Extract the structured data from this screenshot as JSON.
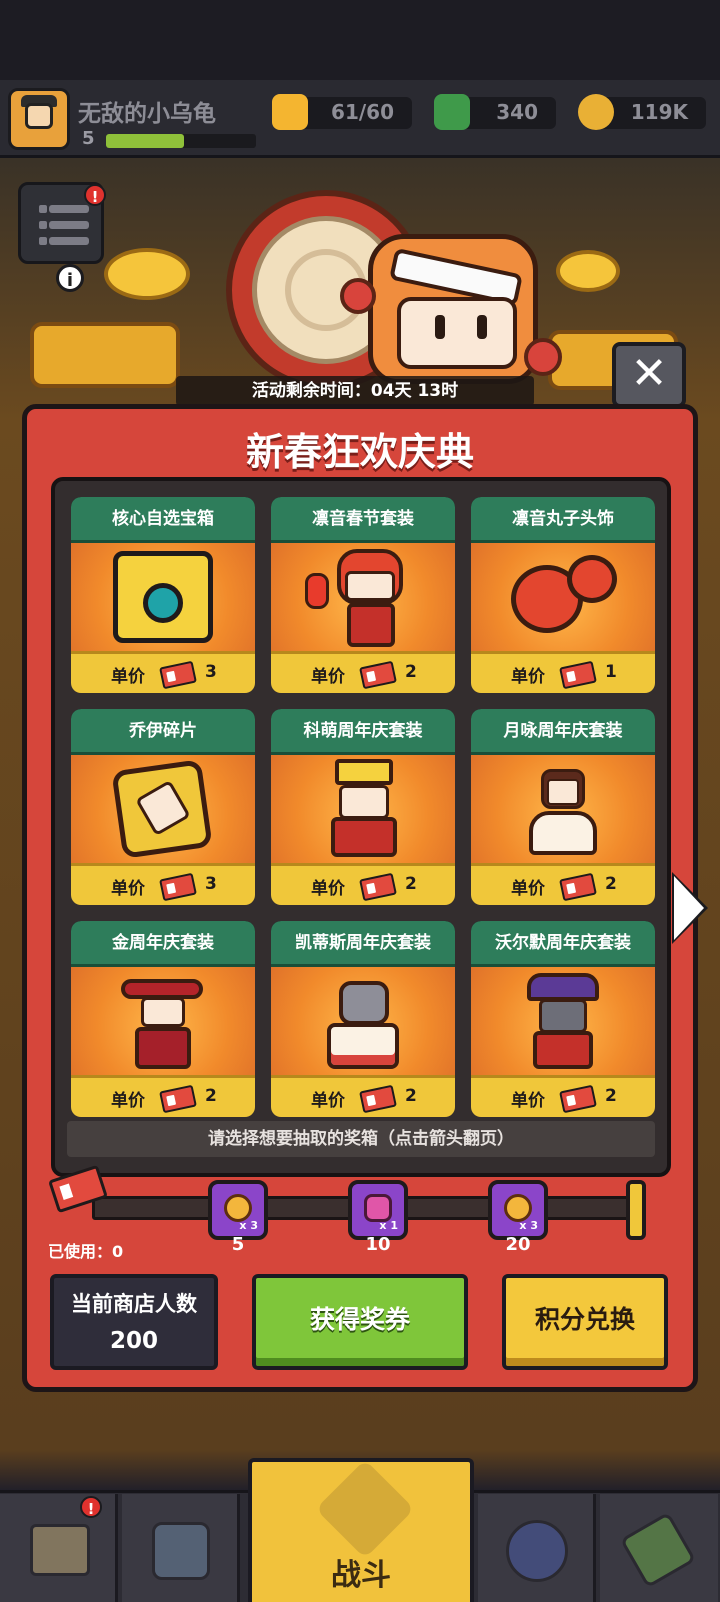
{
  "player": {
    "name": "无敌的小乌龟",
    "level": "5",
    "xp_fraction": 0.52
  },
  "resources": [
    {
      "name": "energy",
      "icon": "lightning-icon",
      "value": "61/60",
      "color": "#f4b530"
    },
    {
      "name": "gems",
      "icon": "gem-icon",
      "value": "340",
      "color": "#3f9a4a"
    },
    {
      "name": "coins",
      "icon": "coin-icon",
      "value": "119K",
      "color": "#e9b035"
    }
  ],
  "menu_badge": "!",
  "info_label": "i",
  "event": {
    "timer": "活动剩余时间：04天 13时",
    "title": "新春狂欢庆典",
    "close_label": "✕",
    "hint": "请选择想要抽取的奖箱（点击箭头翻页）"
  },
  "price_label": "单价",
  "cards": [
    {
      "title": "核心自选宝箱",
      "price": "3"
    },
    {
      "title": "凛音春节套装",
      "price": "2"
    },
    {
      "title": "凛音丸子头饰",
      "price": "1"
    },
    {
      "title": "乔伊碎片",
      "price": "3"
    },
    {
      "title": "科萌周年庆套装",
      "price": "2"
    },
    {
      "title": "月咏周年庆套装",
      "price": "2"
    },
    {
      "title": "金周年庆套装",
      "price": "2"
    },
    {
      "title": "凯蒂斯周年庆套装",
      "price": "2"
    },
    {
      "title": "沃尔默周年庆套装",
      "price": "2"
    }
  ],
  "progress": {
    "used_label": "已使用：0",
    "milestones": [
      {
        "count": "5",
        "reward_qty": "x 3",
        "icon": "key-icon"
      },
      {
        "count": "10",
        "reward_qty": "x 1",
        "icon": "heart-chest-icon"
      },
      {
        "count": "20",
        "reward_qty": "x 3",
        "icon": "key-icon"
      }
    ]
  },
  "shop": {
    "label": "当前商店人数",
    "value": "200"
  },
  "buttons": {
    "get_ticket": "获得奖券",
    "exchange": "积分兑换"
  },
  "nav": {
    "battle_label": "战斗",
    "badge": "!"
  },
  "colors": {
    "panel": "#d6463b",
    "card_header": "#2e7d5b",
    "price_bar": "#f0c73a",
    "milestone": "#8b45c9"
  }
}
